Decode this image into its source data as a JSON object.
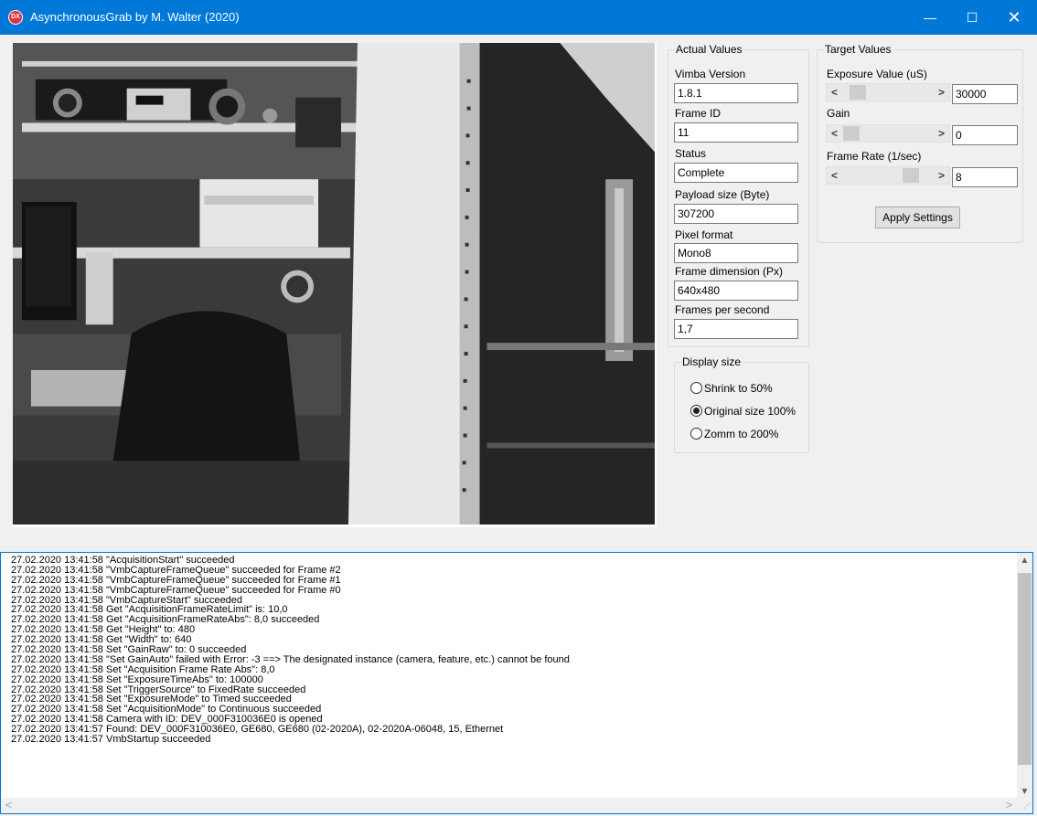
{
  "window": {
    "title": "AsynchronousGrab by M. Walter (2020)",
    "app_icon_text": "DX",
    "minimize_glyph": "—",
    "maximize_glyph": "☐",
    "close_glyph": "✕"
  },
  "actual_values": {
    "title": "Actual Values",
    "fields": [
      {
        "label": "Vimba Version",
        "value": "1.8.1"
      },
      {
        "label": "Frame ID",
        "value": "11"
      },
      {
        "label": "Status",
        "value": "Complete"
      },
      {
        "label": "Payload size (Byte)",
        "value": "307200"
      },
      {
        "label": "Pixel format",
        "value": "Mono8"
      },
      {
        "label": "Frame dimension (Px)",
        "value": "640x480"
      },
      {
        "label": "Frames per second",
        "value": "1,7"
      }
    ]
  },
  "target_values": {
    "title": "Target Values",
    "exposure": {
      "label": "Exposure Value (uS)",
      "value": "30000"
    },
    "gain": {
      "label": "Gain",
      "value": "0"
    },
    "frame_rate": {
      "label": "Frame Rate (1/sec)",
      "value": "8"
    },
    "apply_label": "Apply Settings"
  },
  "display_size": {
    "title": "Display size",
    "options": [
      {
        "label": "Shrink to 50%",
        "checked": false
      },
      {
        "label": "Original size 100%",
        "checked": true
      },
      {
        "label": "Zomm to 200%",
        "checked": false
      }
    ]
  },
  "scroll_glyphs": {
    "up": "▲",
    "down": "▼",
    "left": "<",
    "right": ">"
  },
  "log": [
    "27.02.2020 13:41:58  \"AcquisitionStart\" succeeded",
    "27.02.2020 13:41:58  \"VmbCaptureFrameQueue\" succeeded for Frame #2",
    "27.02.2020 13:41:58  \"VmbCaptureFrameQueue\" succeeded for Frame #1",
    "27.02.2020 13:41:58  \"VmbCaptureFrameQueue\" succeeded for Frame #0",
    "27.02.2020 13:41:58  \"VmbCaptureStart\" succeeded",
    "27.02.2020 13:41:58  Get \"AcquisitionFrameRateLimit\" is: 10,0",
    "27.02.2020 13:41:58  Get \"AcquisitionFrameRateAbs\": 8,0 succeeded",
    "27.02.2020 13:41:58  Get \"Height\" to: 480",
    "27.02.2020 13:41:58  Get \"Width\" to: 640",
    "27.02.2020 13:41:58  Set \"GainRaw\" to: 0 succeeded",
    "27.02.2020 13:41:58  \"Set GainAuto\" failed with Error: -3 ==> The designated instance (camera, feature, etc.) cannot be found",
    "27.02.2020 13:41:58  Set \"Acquisition Frame Rate Abs\": 8,0",
    "27.02.2020 13:41:58  Set \"ExposureTimeAbs\" to: 100000",
    "27.02.2020 13:41:58  Set \"TriggerSource\" to FixedRate succeeded",
    "27.02.2020 13:41:58  Set \"ExposureMode\" to Timed succeeded",
    "27.02.2020 13:41:58  Set \"AcquisitionMode\" to Continuous succeeded",
    "27.02.2020 13:41:58  Camera with ID: DEV_000F310036E0 is opened",
    "27.02.2020 13:41:57  Found: DEV_000F310036E0, GE680, GE680 (02-2020A), 02-2020A-06048, 15, Ethernet",
    "27.02.2020 13:41:57  VmbStartup succeeded"
  ]
}
